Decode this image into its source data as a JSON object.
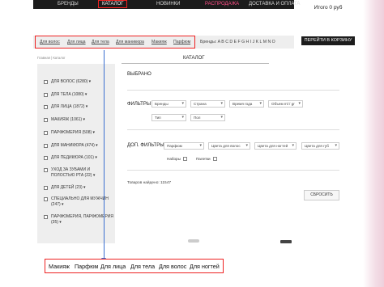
{
  "topnav": {
    "items": [
      {
        "label": "БРЕНДЫ"
      },
      {
        "label": "КАТАЛОГ"
      },
      {
        "label": "НОВИНКИ"
      },
      {
        "label": "РАСПРОДАЖА"
      },
      {
        "label": "ДОСТАВКА И ОПЛАТА"
      }
    ],
    "active_color": "#ff4e86"
  },
  "cart": {
    "total": "Итого 0 руб",
    "button": "ПЕРЕЙТИ В КОРЗИНУ"
  },
  "subnav": {
    "items": [
      "Для волос",
      "Для лица",
      "Для тела",
      "Для маникюра",
      "Макияж",
      "Парфюм"
    ],
    "brands": "Бренды: A B C D E F G H I J K L M N O"
  },
  "breadcrumb": "Главная | Каталог",
  "catalog_title": "КАТАЛОГ",
  "sidebar": {
    "categories": [
      "ДЛЯ ВОЛОС (6280) ▾",
      "ДЛЯ ТЕЛА (1080) ▾",
      "ДЛЯ ЛИЦА (1872) ▾",
      "МАКИЯЖ (1061) ▾",
      "ПАРФЮМЕРИЯ (508) ▾",
      "ДЛЯ МАНИКЮРА (474) ▾",
      "ДЛЯ ПЕДИКЮРА (101) ▾",
      "УХОД ЗА ЗУБАМИ И ПОЛОСТЬЮ РТА (22) ▾",
      "ДЛЯ ДЕТЕЙ (23) ▾",
      "СПЕЦИАЛЬНО ДЛЯ МУЖЧИН (247) ▾",
      "ПАРФЮМЕРИЯ, ПАРФЮМЕРИЯ (35) ▾"
    ]
  },
  "main": {
    "selected": "ВЫБРАНО",
    "filters_label": "ФИЛЬТРЫ",
    "filters_row1": [
      "Бренды",
      "Страна",
      "Время года",
      "Объем ml / gr"
    ],
    "filters_row2": [
      "Тип",
      "Пол"
    ],
    "dop_label": "ДОП. ФИЛЬТРЫ",
    "dop_row": [
      "Парфюм",
      "Цвета для волос",
      "Цвета для ногтей",
      "Цвета для губ"
    ],
    "checkbox1": "Наборы",
    "checkbox2": "Палетки",
    "found": "Товаров найдено: 11547",
    "reset": "СБРОСИТЬ"
  },
  "callout": {
    "items": [
      "Макияж",
      "Парфюм",
      "Для лица",
      "Для тела",
      "Для волос",
      "Для ногтей"
    ]
  },
  "colors": {
    "highlight": "#e22222",
    "arrow": "#3b6fd0",
    "nav_bg": "#1c1c1c"
  }
}
